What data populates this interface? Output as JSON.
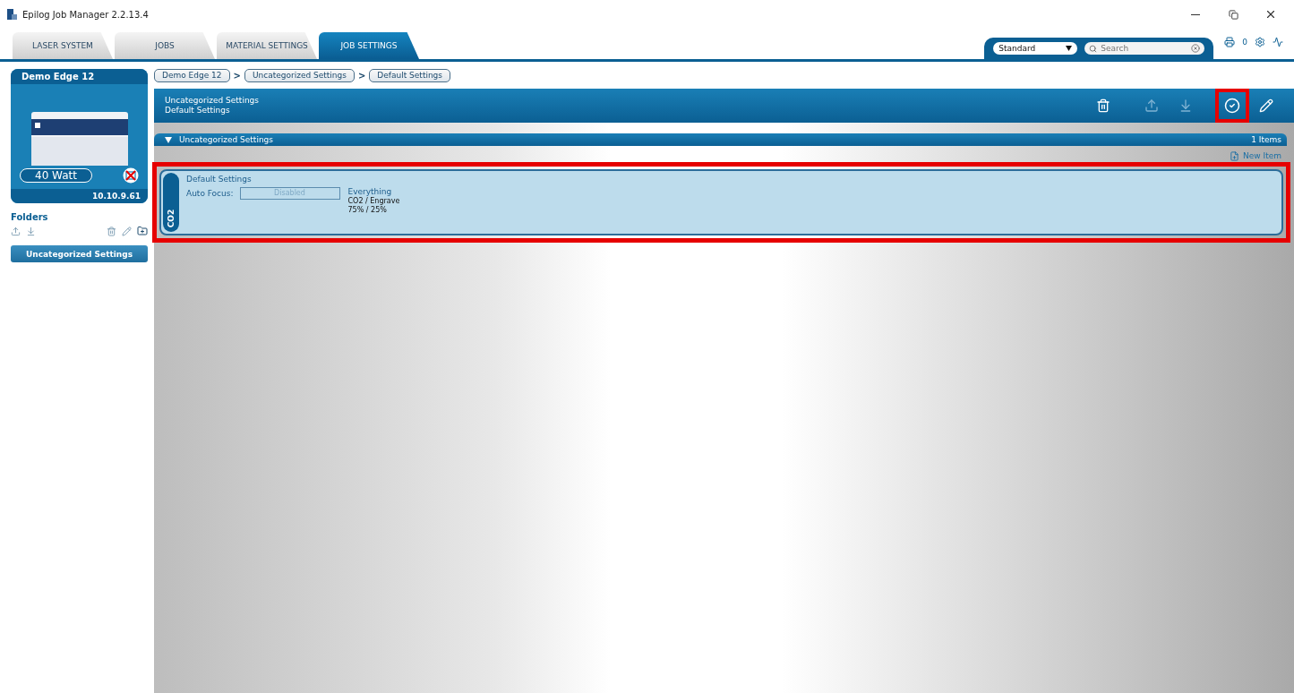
{
  "window": {
    "title": "Epilog Job Manager 2.2.13.4"
  },
  "tabs": [
    {
      "label": "LASER SYSTEM",
      "selected": false
    },
    {
      "label": "JOBS",
      "selected": false
    },
    {
      "label": "MATERIAL SETTINGS",
      "selected": false
    },
    {
      "label": "JOB SETTINGS",
      "selected": true
    }
  ],
  "toolbar": {
    "preset": "Standard",
    "search": {
      "placeholder": "Search"
    },
    "print_count": "0"
  },
  "device": {
    "name": "Demo Edge 12",
    "wattage": "40 Watt",
    "ip": "10.10.9.61"
  },
  "folders": {
    "title": "Folders",
    "items": [
      {
        "label": "Uncategorized Settings",
        "selected": true
      }
    ]
  },
  "breadcrumbs": [
    {
      "label": "Demo Edge 12"
    },
    {
      "separator": ">",
      "label": "Uncategorized Settings"
    },
    {
      "separator": ">",
      "label": "Default Settings"
    }
  ],
  "header": {
    "lines": [
      "Uncategorized Settings",
      "Default Settings"
    ],
    "actions": [
      {
        "kind": "delete",
        "highlighted": false
      },
      {
        "kind": "export",
        "highlighted": false
      },
      {
        "kind": "import",
        "highlighted": false
      },
      {
        "kind": "apply",
        "highlighted": true
      },
      {
        "kind": "edit",
        "highlighted": false
      }
    ]
  },
  "section": {
    "title": "Uncategorized Settings",
    "expanded": true,
    "count": "1 Items",
    "new_item": "New Item"
  },
  "items": [
    {
      "badge": "CO2",
      "name": "Default Settings",
      "autofocus_label": "Auto Focus:",
      "autofocus_value": "Disabled",
      "summary": "Everything",
      "mode": "CO2 / Engrave",
      "power": "75% / 25%",
      "highlighted": true
    }
  ]
}
